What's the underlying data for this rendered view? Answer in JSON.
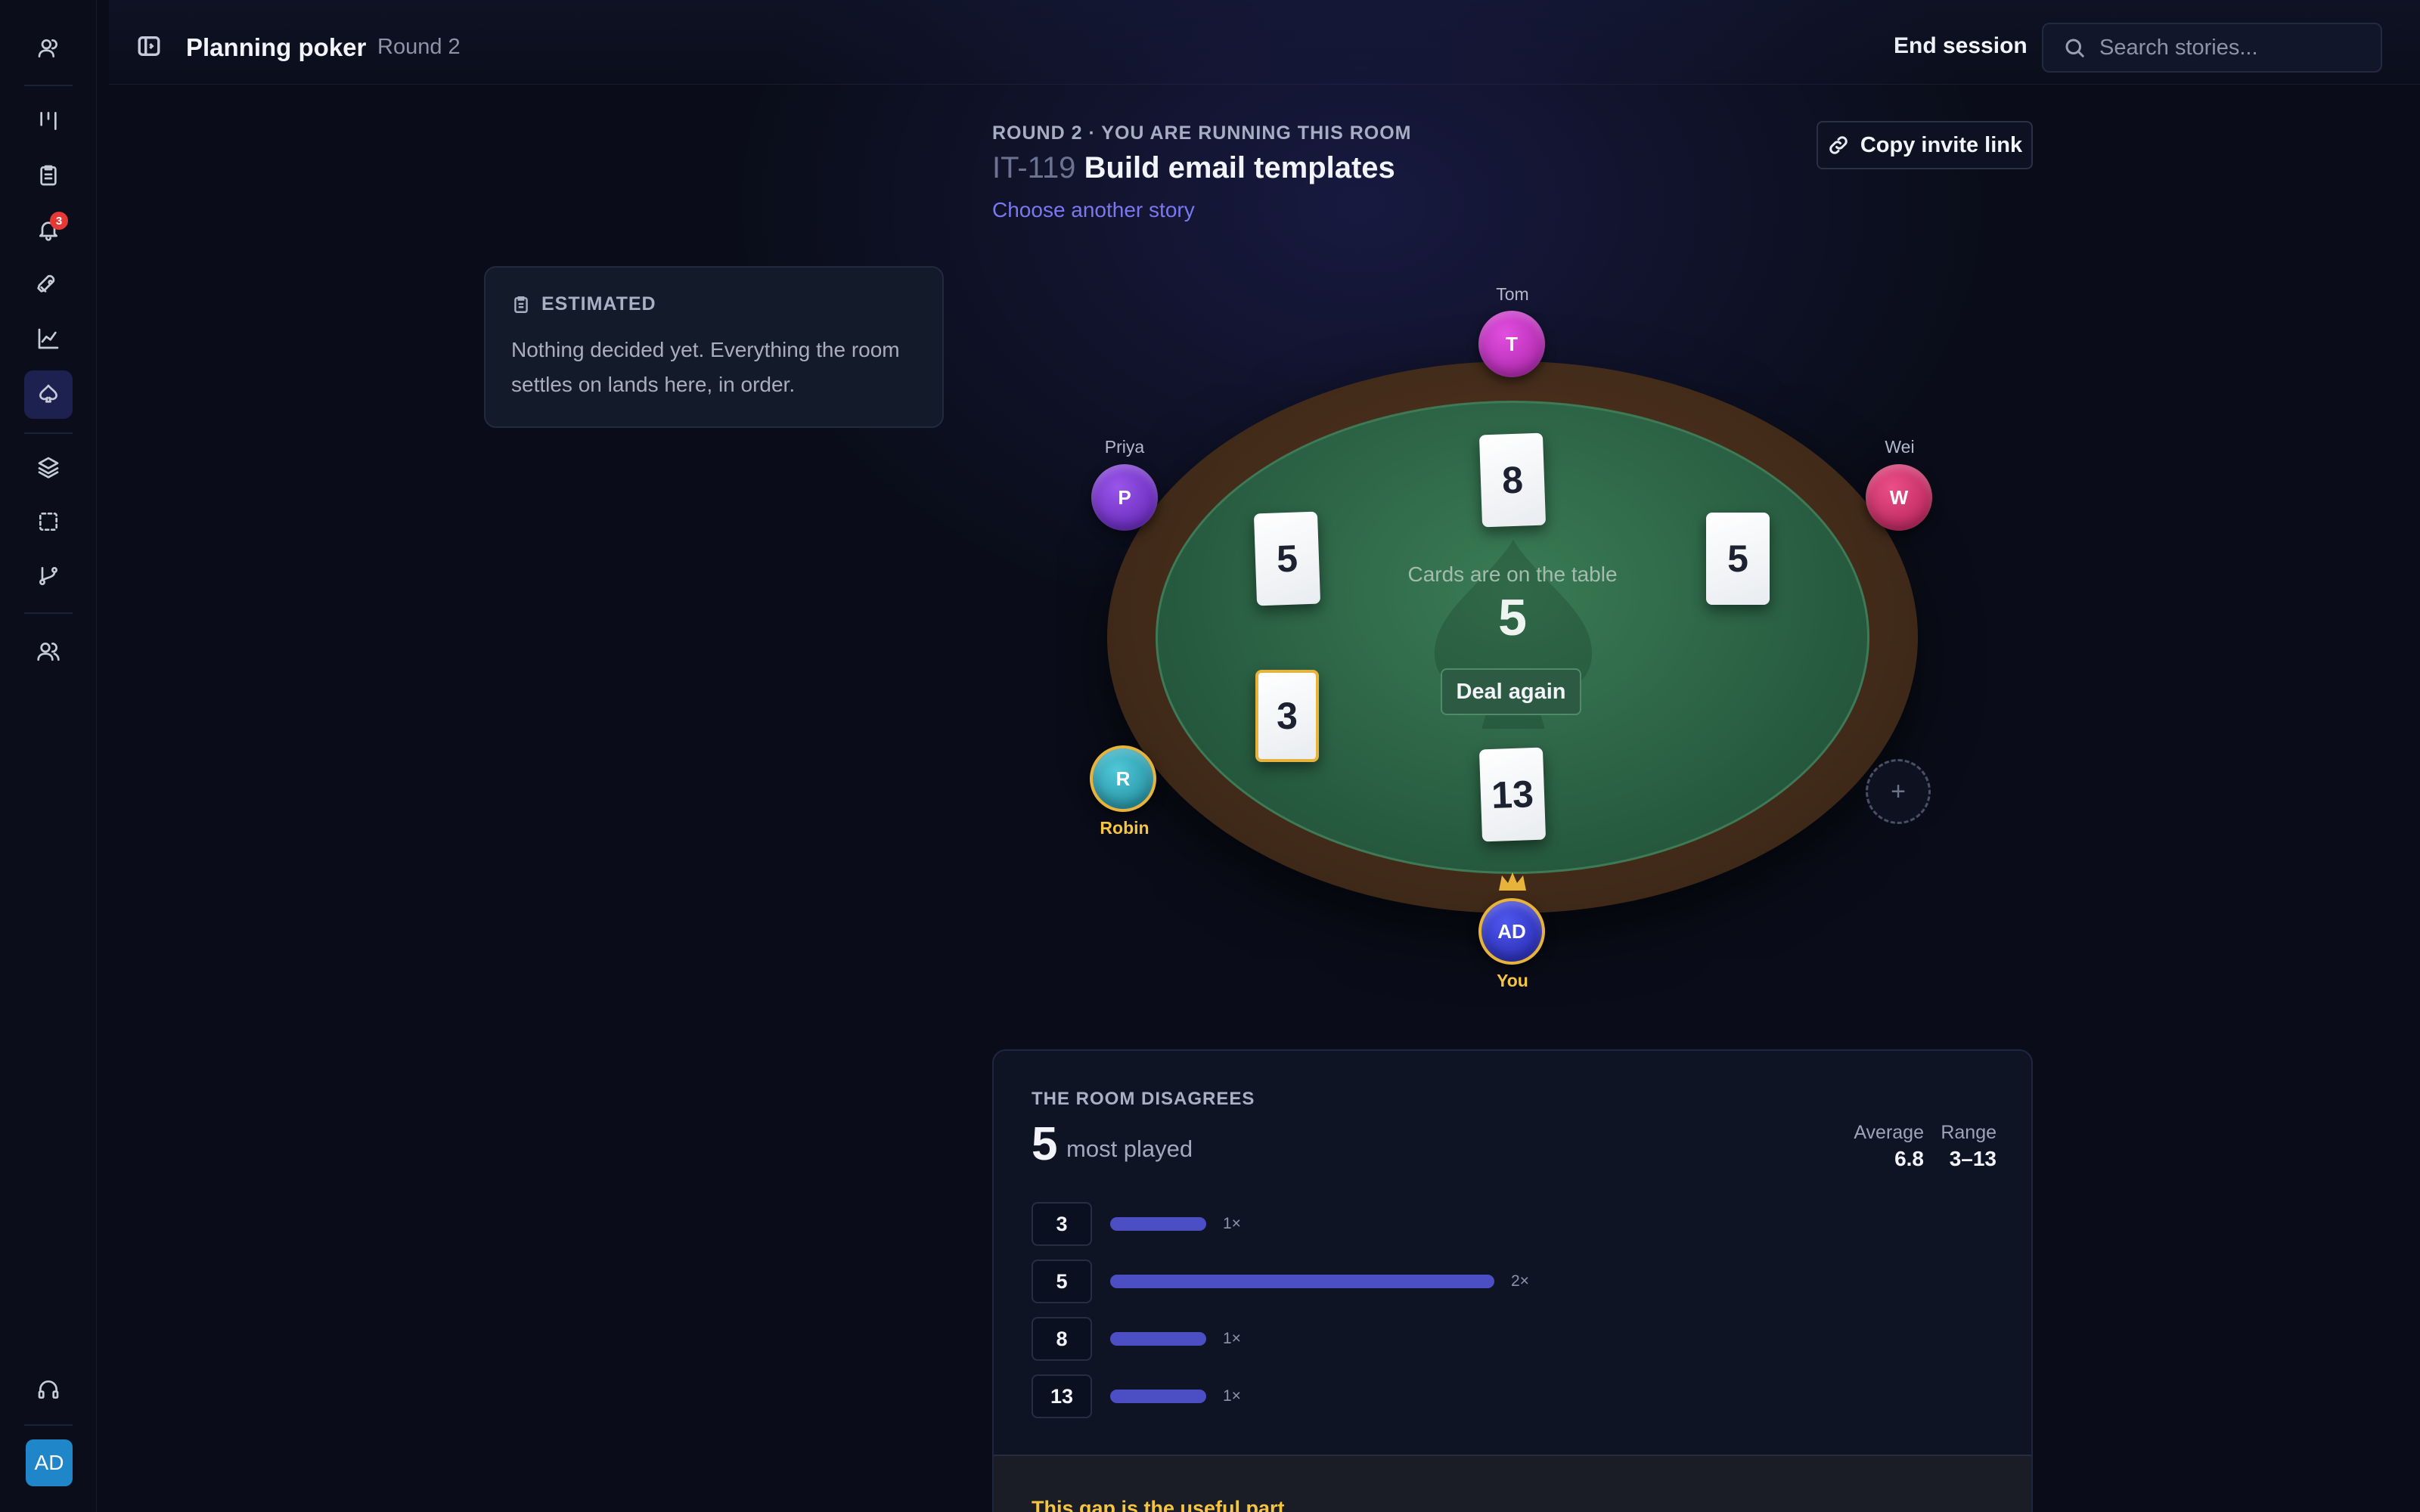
{
  "sidebar": {
    "icons": [
      "users-icon",
      "board-icon",
      "clipboard-icon",
      "bell-icon",
      "rocket-icon",
      "chart-icon",
      "spade-icon",
      "layers-icon",
      "selection-icon",
      "branch-icon",
      "team-icon",
      "headset-icon"
    ],
    "notification_count": "3",
    "avatar_initials": "AD",
    "avatar_color": "#1f86c9",
    "active_item": "spade-icon"
  },
  "header": {
    "title": "Planning poker",
    "round": "Round 2",
    "end_session": "End session",
    "search_placeholder": "Search stories..."
  },
  "story": {
    "kicker": "ROUND 2 · YOU ARE RUNNING THIS ROOM",
    "key": "IT-119",
    "title": "Build email templates",
    "change_link": "Choose another story",
    "invite_label": "Copy invite link"
  },
  "estimated": {
    "title": "ESTIMATED",
    "body": "Nothing decided yet. Everything the room settles on lands here, in order."
  },
  "table": {
    "center_label": "Cards are on the table",
    "center_value": "5",
    "deal_again": "Deal again",
    "felt_color": "#2a6043",
    "players": [
      {
        "name": "Tom",
        "initials": "T",
        "color": "#b62bb5",
        "card": "8"
      },
      {
        "name": "Priya",
        "initials": "P",
        "color": "#6a2bc2",
        "card": "5"
      },
      {
        "name": "Wei",
        "initials": "W",
        "color": "#c2285f",
        "card": "5"
      },
      {
        "name": "Robin",
        "initials": "R",
        "color": "#2a9db0",
        "card": "3"
      },
      {
        "name": "You",
        "initials": "AD",
        "color": "#2f35c8",
        "card": "13"
      }
    ],
    "add_seat": "+"
  },
  "results": {
    "kicker": "THE ROOM DISAGREES",
    "most_played_value": "5",
    "most_played_label": "most played",
    "average_label": "Average",
    "average_value": "6.8",
    "range_label": "Range",
    "range_value": "3–13",
    "votes": [
      {
        "value": "3",
        "count": 1,
        "count_label": "1×"
      },
      {
        "value": "5",
        "count": 2,
        "count_label": "2×"
      },
      {
        "value": "8",
        "count": 1,
        "count_label": "1×"
      },
      {
        "value": "13",
        "count": 1,
        "count_label": "1×"
      }
    ],
    "bar_color": "#4c4fc4",
    "gap_title": "This gap is the useful part"
  }
}
